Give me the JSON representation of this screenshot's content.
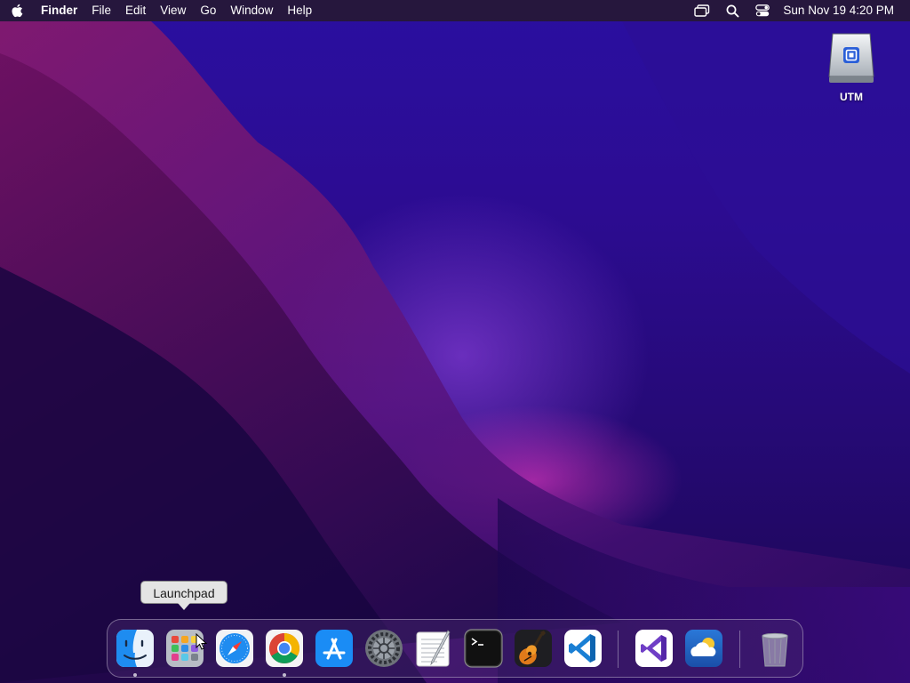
{
  "menubar": {
    "apple_icon": "apple-logo-icon",
    "app_name": "Finder",
    "menus": [
      "File",
      "Edit",
      "View",
      "Go",
      "Window",
      "Help"
    ],
    "status_icons": [
      "screen-mirroring-icon",
      "spotlight-search-icon",
      "control-center-icon"
    ],
    "clock": "Sun Nov 19  4:20 PM"
  },
  "desktop": {
    "icons": [
      {
        "label": "UTM",
        "icon": "external-drive-icon"
      }
    ]
  },
  "tooltip": {
    "text": "Launchpad"
  },
  "dock": {
    "apps": [
      {
        "name": "Finder",
        "icon": "finder-icon",
        "running": true
      },
      {
        "name": "Launchpad",
        "icon": "launchpad-icon",
        "running": false
      },
      {
        "name": "Safari",
        "icon": "safari-icon",
        "running": false
      },
      {
        "name": "Google Chrome",
        "icon": "chrome-icon",
        "running": true
      },
      {
        "name": "App Store",
        "icon": "app-store-icon",
        "running": false
      },
      {
        "name": "System Settings",
        "icon": "settings-gear-icon",
        "running": false
      },
      {
        "name": "TextEdit",
        "icon": "textedit-icon",
        "running": false
      },
      {
        "name": "Terminal",
        "icon": "terminal-icon",
        "running": false
      },
      {
        "name": "GarageBand",
        "icon": "guitar-icon",
        "running": false
      },
      {
        "name": "Visual Studio Code",
        "icon": "vscode-icon",
        "running": false
      },
      {
        "name": "Visual Studio",
        "icon": "visual-studio-icon",
        "running": false
      },
      {
        "name": "Weather",
        "icon": "weather-icon",
        "running": false
      },
      {
        "name": "Trash",
        "icon": "trash-icon",
        "running": false
      }
    ]
  },
  "colors": {
    "wallpaper_top": "#2a0fa0",
    "wallpaper_ridge": "#8a1470",
    "wallpaper_glow": "#ff3cc8",
    "menubar_bg": "#261834",
    "tooltip_bg": "#e4e4e4"
  }
}
